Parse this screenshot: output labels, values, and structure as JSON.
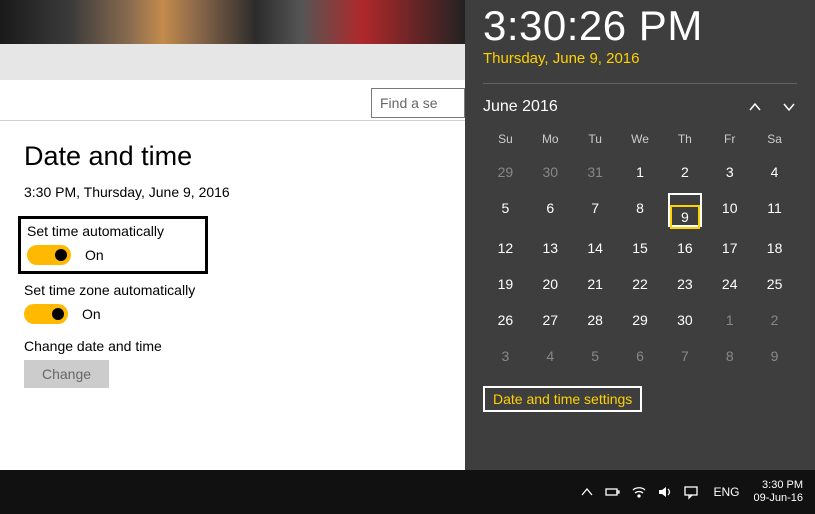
{
  "search": {
    "placeholder": "Find a se"
  },
  "settings": {
    "heading": "Date and time",
    "current": "3:30 PM, Thursday, June 9, 2016",
    "autoTime": {
      "label": "Set time automatically",
      "state": "On"
    },
    "autoZone": {
      "label": "Set time zone automatically",
      "state": "On"
    },
    "changeLabel": "Change date and time",
    "changeBtn": "Change"
  },
  "flyout": {
    "time": "3:30:26 PM",
    "date": "Thursday, June 9, 2016",
    "month": "June 2016",
    "dow": [
      "Su",
      "Mo",
      "Tu",
      "We",
      "Th",
      "Fr",
      "Sa"
    ],
    "weeks": [
      [
        {
          "d": "29",
          "dim": true
        },
        {
          "d": "30",
          "dim": true
        },
        {
          "d": "31",
          "dim": true
        },
        {
          "d": "1"
        },
        {
          "d": "2"
        },
        {
          "d": "3"
        },
        {
          "d": "4"
        }
      ],
      [
        {
          "d": "5"
        },
        {
          "d": "6"
        },
        {
          "d": "7"
        },
        {
          "d": "8"
        },
        {
          "d": "9",
          "today": true
        },
        {
          "d": "10"
        },
        {
          "d": "11"
        }
      ],
      [
        {
          "d": "12"
        },
        {
          "d": "13"
        },
        {
          "d": "14"
        },
        {
          "d": "15"
        },
        {
          "d": "16"
        },
        {
          "d": "17"
        },
        {
          "d": "18"
        }
      ],
      [
        {
          "d": "19"
        },
        {
          "d": "20"
        },
        {
          "d": "21"
        },
        {
          "d": "22"
        },
        {
          "d": "23"
        },
        {
          "d": "24"
        },
        {
          "d": "25"
        }
      ],
      [
        {
          "d": "26"
        },
        {
          "d": "27"
        },
        {
          "d": "28"
        },
        {
          "d": "29"
        },
        {
          "d": "30"
        },
        {
          "d": "1",
          "dim": true
        },
        {
          "d": "2",
          "dim": true
        }
      ],
      [
        {
          "d": "3",
          "dim": true
        },
        {
          "d": "4",
          "dim": true
        },
        {
          "d": "5",
          "dim": true
        },
        {
          "d": "6",
          "dim": true
        },
        {
          "d": "7",
          "dim": true
        },
        {
          "d": "8",
          "dim": true
        },
        {
          "d": "9",
          "dim": true
        }
      ]
    ],
    "link": "Date and time settings"
  },
  "taskbar": {
    "lang": "ENG",
    "time": "3:30 PM",
    "date": "09-Jun-16"
  }
}
